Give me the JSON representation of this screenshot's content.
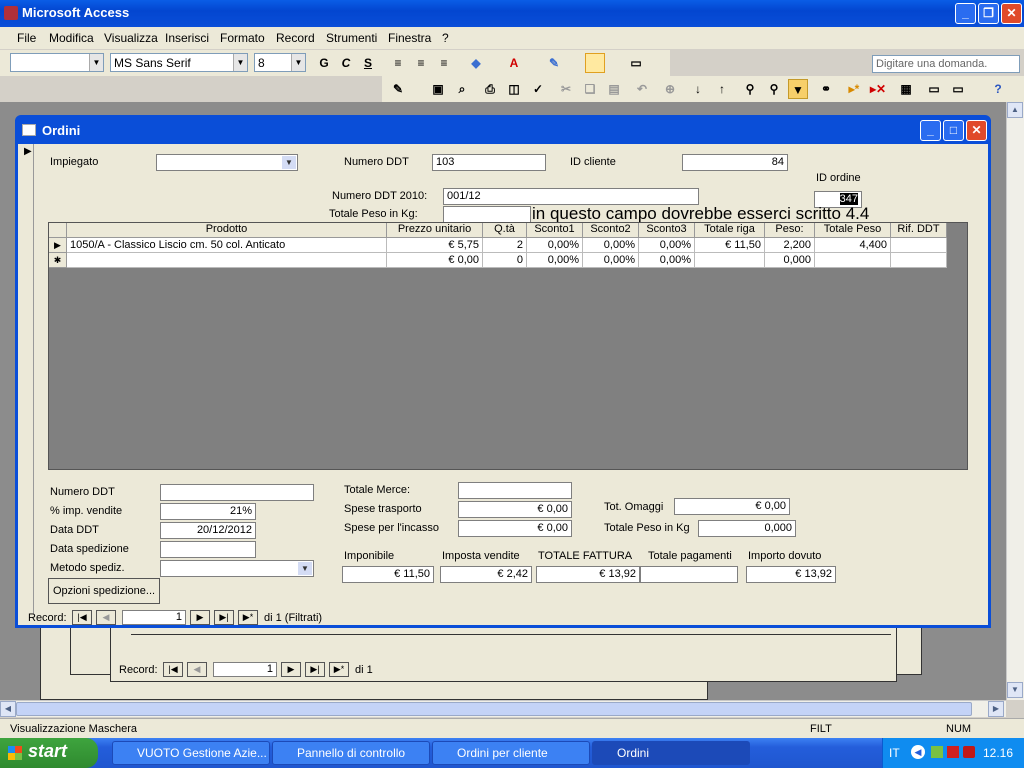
{
  "app": {
    "title": "Microsoft Access"
  },
  "menu": {
    "items": [
      "File",
      "Modifica",
      "Visualizza",
      "Inserisci",
      "Formato",
      "Record",
      "Strumenti",
      "Finestra",
      "?"
    ],
    "question_placeholder": "Digitare una domanda."
  },
  "toolbar": {
    "font_name": "MS Sans Serif",
    "font_size": "8",
    "bold": "G",
    "italic": "C",
    "underline": "S"
  },
  "form": {
    "title": "Ordini",
    "impiegato_label": "Impiegato",
    "impiegato_value": "",
    "numero_ddt_label": "Numero DDT",
    "numero_ddt_value": "103",
    "id_cliente_label": "ID cliente",
    "id_cliente_value": "84",
    "id_ordine_label": "ID ordine",
    "id_ordine_value": "347",
    "numero_ddt_2010_label": "Numero DDT 2010:",
    "numero_ddt_2010_value": "001/12",
    "totale_peso_kg_label": "Totale Peso in Kg:",
    "totale_peso_kg_value": "",
    "annotation": "in questo campo dovrebbe esserci scritto 4.4",
    "grid": {
      "headers": [
        "Prodotto",
        "Prezzo unitario",
        "Q.tà",
        "Sconto1",
        "Sconto2",
        "Sconto3",
        "Totale riga",
        "Peso:",
        "Totale Peso",
        "Rif. DDT"
      ],
      "rows": [
        [
          "1050/A - Classico Liscio cm. 50 col. Anticato",
          "€ 5,75",
          "2",
          "0,00%",
          "0,00%",
          "0,00%",
          "€ 11,50",
          "2,200",
          "4,400",
          ""
        ],
        [
          "",
          "€ 0,00",
          "0",
          "0,00%",
          "0,00%",
          "0,00%",
          "",
          "0,000",
          "",
          ""
        ]
      ]
    },
    "bottom": {
      "numero_ddt_label": "Numero DDT",
      "numero_ddt_value": "",
      "imp_vendite_label": "% imp. vendite",
      "imp_vendite_value": "21%",
      "data_ddt_label": "Data DDT",
      "data_ddt_value": "20/12/2012",
      "data_spedizione_label": "Data spedizione",
      "data_spedizione_value": "",
      "metodo_spediz_label": "Metodo spediz.",
      "metodo_spediz_value": "",
      "opzioni_button": "Opzioni spedizione...",
      "totale_merce_label": "Totale Merce:",
      "totale_merce_value": "",
      "spese_trasporto_label": "Spese trasporto",
      "spese_trasporto_value": "€ 0,00",
      "spese_incasso_label": "Spese per l'incasso",
      "spese_incasso_value": "€ 0,00",
      "tot_omaggi_label": "Tot. Omaggi",
      "tot_omaggi_value": "€ 0,00",
      "totale_peso_kg_label": "Totale Peso in Kg",
      "totale_peso_kg_value": "0,000",
      "imponibile_label": "Imponibile",
      "imponibile_value": "€ 11,50",
      "imposta_vendite_label": "Imposta  vendite",
      "imposta_vendite_value": "€ 2,42",
      "totale_fattura_label": "TOTALE FATTURA",
      "totale_fattura_value": "€ 13,92",
      "totale_pagamenti_label": "Totale pagamenti",
      "totale_pagamenti_value": "",
      "importo_dovuto_label": "Importo dovuto",
      "importo_dovuto_value": "€ 13,92"
    },
    "nav": {
      "label": "Record:",
      "current": "1",
      "total": "di 1 (Filtrati)"
    }
  },
  "back_nav": {
    "label": "Record:",
    "current": "1",
    "total": "di 1"
  },
  "status": {
    "text": "Visualizzazione Maschera",
    "filt": "FILT",
    "num": "NUM"
  },
  "taskbar": {
    "start": "start",
    "tasks": [
      "VUOTO Gestione Azie...",
      "Pannello di controllo",
      "Ordini per cliente",
      "Ordini"
    ],
    "lang": "IT",
    "clock": "12.16"
  }
}
